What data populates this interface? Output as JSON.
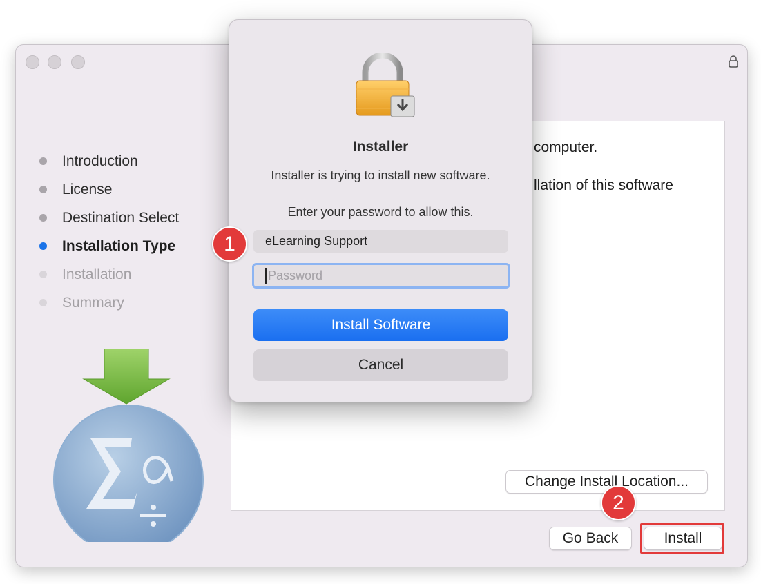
{
  "window": {
    "steps": [
      {
        "label": "Introduction",
        "state": "done"
      },
      {
        "label": "License",
        "state": "done"
      },
      {
        "label": "Destination Select",
        "state": "done"
      },
      {
        "label": "Installation Type",
        "state": "active"
      },
      {
        "label": "Installation",
        "state": "pending"
      },
      {
        "label": "Summary",
        "state": "pending"
      }
    ],
    "content_lines": [
      "computer.",
      "llation of this software"
    ],
    "buttons": {
      "change_location": "Change Install Location...",
      "go_back": "Go Back",
      "install": "Install"
    }
  },
  "dialog": {
    "title": "Installer",
    "message": "Installer is trying to install new software.",
    "prompt": "Enter your password to allow this.",
    "username": "eLearning Support",
    "password_placeholder": "Password",
    "primary_button": "Install Software",
    "cancel_button": "Cancel"
  },
  "callouts": [
    "1",
    "2"
  ],
  "colors": {
    "accent": "#1a73e8",
    "callout": "#e23a3a"
  },
  "icons": [
    "lock-icon",
    "installer-lock-icon",
    "app-logo-icon"
  ]
}
